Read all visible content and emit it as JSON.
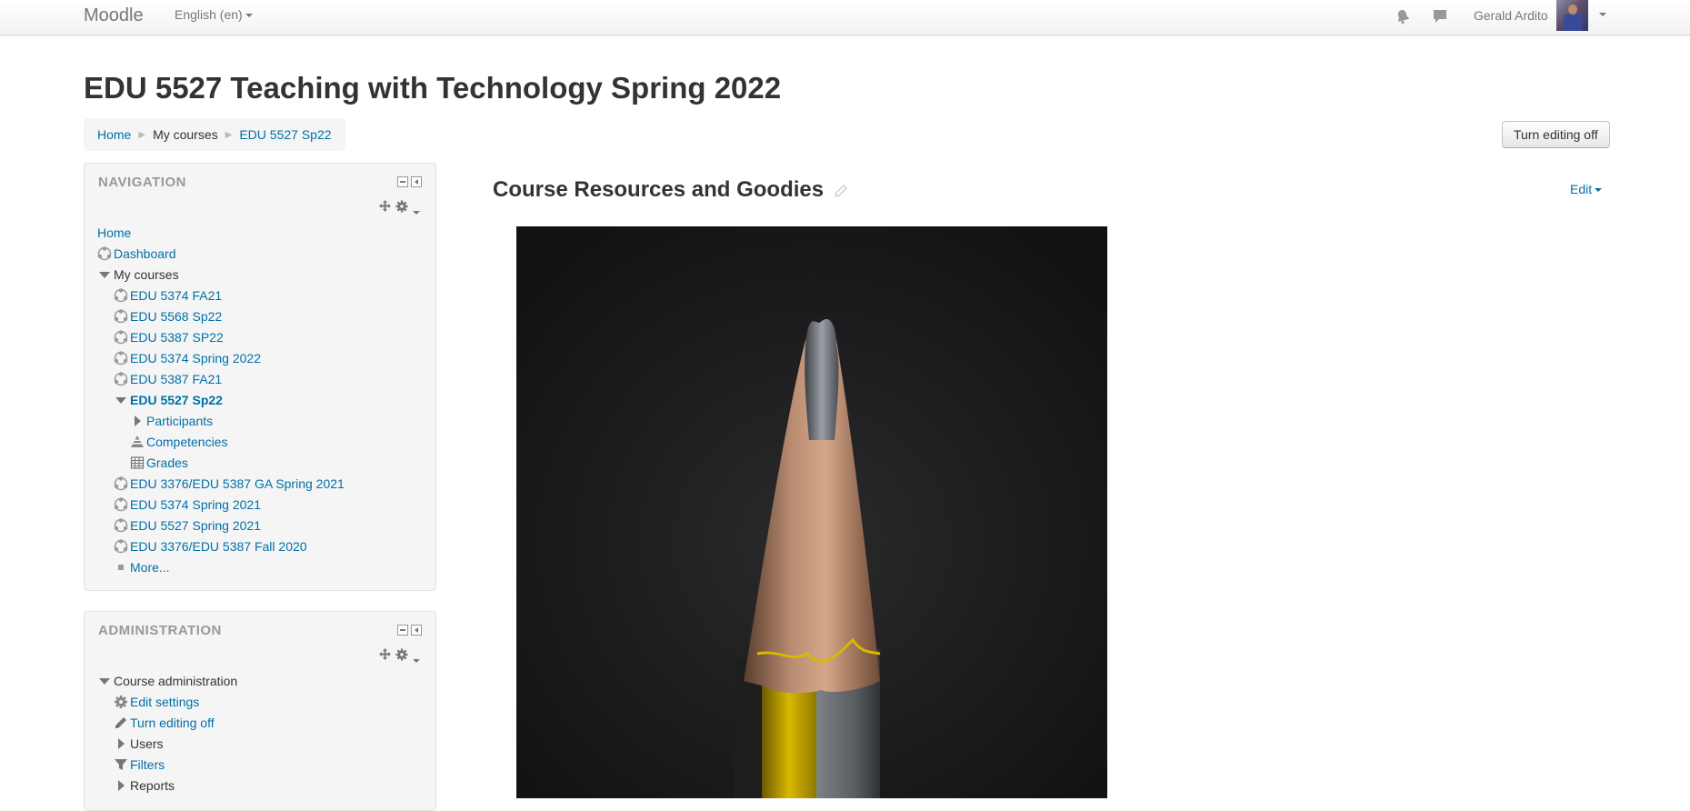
{
  "navbar": {
    "brand": "Moodle",
    "language": "English (en)",
    "user_name": "Gerald Ardito",
    "icons": [
      "notifications-bell-icon",
      "messages-icon"
    ]
  },
  "header": {
    "title": "EDU 5527 Teaching with Technology Spring 2022",
    "breadcrumb": [
      "Home",
      "My courses",
      "EDU 5527 Sp22"
    ],
    "turn_editing_off": "Turn editing off"
  },
  "navigation": {
    "title": "NAVIGATION",
    "home": "Home",
    "dashboard": "Dashboard",
    "my_courses": "My courses",
    "courses": [
      "EDU 5374 FA21",
      "EDU 5568 Sp22",
      "EDU 5387 SP22",
      "EDU 5374 Spring 2022",
      "EDU 5387 FA21",
      "EDU 5527 Sp22"
    ],
    "current_course_children": [
      "Participants",
      "Competencies",
      "Grades"
    ],
    "more_courses": [
      "EDU 3376/EDU 5387 GA Spring 2021",
      "EDU 5374 Spring 2021",
      "EDU 5527 Spring 2021",
      "EDU 3376/EDU 5387 Fall 2020"
    ],
    "more": "More..."
  },
  "administration": {
    "title": "ADMINISTRATION",
    "course_admin": "Course administration",
    "items": [
      "Edit settings",
      "Turn editing off",
      "Users",
      "Filters",
      "Reports"
    ]
  },
  "main": {
    "section_title": "Course Resources and Goodies",
    "edit_menu": "Edit"
  },
  "colors": {
    "link": "#0070a8",
    "text": "#333333",
    "block_bg": "#f5f5f5",
    "image_bg": "#1c1c1e",
    "pencil_yellow": "#d9b800"
  }
}
